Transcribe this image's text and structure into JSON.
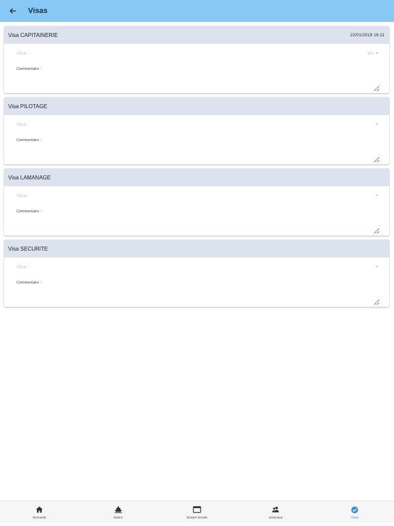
{
  "appbar": {
    "title": "Visas"
  },
  "cards": [
    {
      "title": "Visa CAPITAINERIE",
      "date": "22/01/2019 16:11",
      "visa_label": "Visa :",
      "visa_value": "Vu",
      "comment_label": "Commentaire :"
    },
    {
      "title": "Visa PILOTAGE",
      "date": "",
      "visa_label": "Visa :",
      "visa_value": "",
      "comment_label": "Commentaire :"
    },
    {
      "title": "Visa LAMANAGE",
      "date": "",
      "visa_label": "Visa :",
      "visa_value": "",
      "comment_label": "Commentaire :"
    },
    {
      "title": "Visa SECURITE",
      "date": "",
      "visa_label": "Visa :",
      "visa_value": "",
      "comment_label": "Commentaire :"
    }
  ],
  "nav": {
    "items": [
      {
        "label": "Demande",
        "icon": "home-icon"
      },
      {
        "label": "Navire",
        "icon": "ship-icon"
      },
      {
        "label": "Dossier Escale",
        "icon": "folder-window-icon"
      },
      {
        "label": "Historique",
        "icon": "people-icon"
      },
      {
        "label": "Visas",
        "icon": "check-circle-icon",
        "active": true
      }
    ],
    "active_color": "#3a8ee6"
  },
  "colors": {
    "appbar": "#87c9f4",
    "card_header": "#dce3ef"
  }
}
